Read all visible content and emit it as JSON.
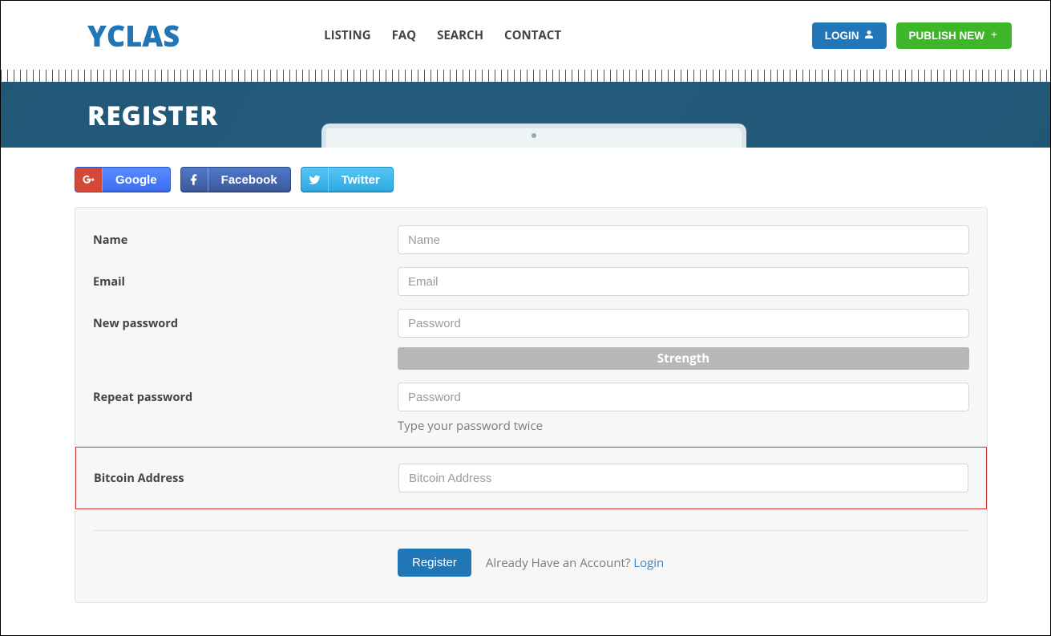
{
  "brand": "YCLAS",
  "nav": {
    "listing": "LISTING",
    "faq": "FAQ",
    "search": "SEARCH",
    "contact": "CONTACT"
  },
  "header_buttons": {
    "login": "LOGIN",
    "publish": "PUBLISH NEW"
  },
  "hero": {
    "title": "REGISTER"
  },
  "social": {
    "google": "Google",
    "facebook": "Facebook",
    "twitter": "Twitter"
  },
  "form": {
    "name": {
      "label": "Name",
      "placeholder": "Name"
    },
    "email": {
      "label": "Email",
      "placeholder": "Email"
    },
    "password": {
      "label": "New password",
      "placeholder": "Password",
      "strength_label": "Strength"
    },
    "repeat": {
      "label": "Repeat password",
      "placeholder": "Password",
      "help": "Type your password twice"
    },
    "bitcoin": {
      "label": "Bitcoin Address",
      "placeholder": "Bitcoin Address"
    },
    "submit": "Register",
    "already_text": "Already Have an Account? ",
    "login_link": "Login"
  }
}
